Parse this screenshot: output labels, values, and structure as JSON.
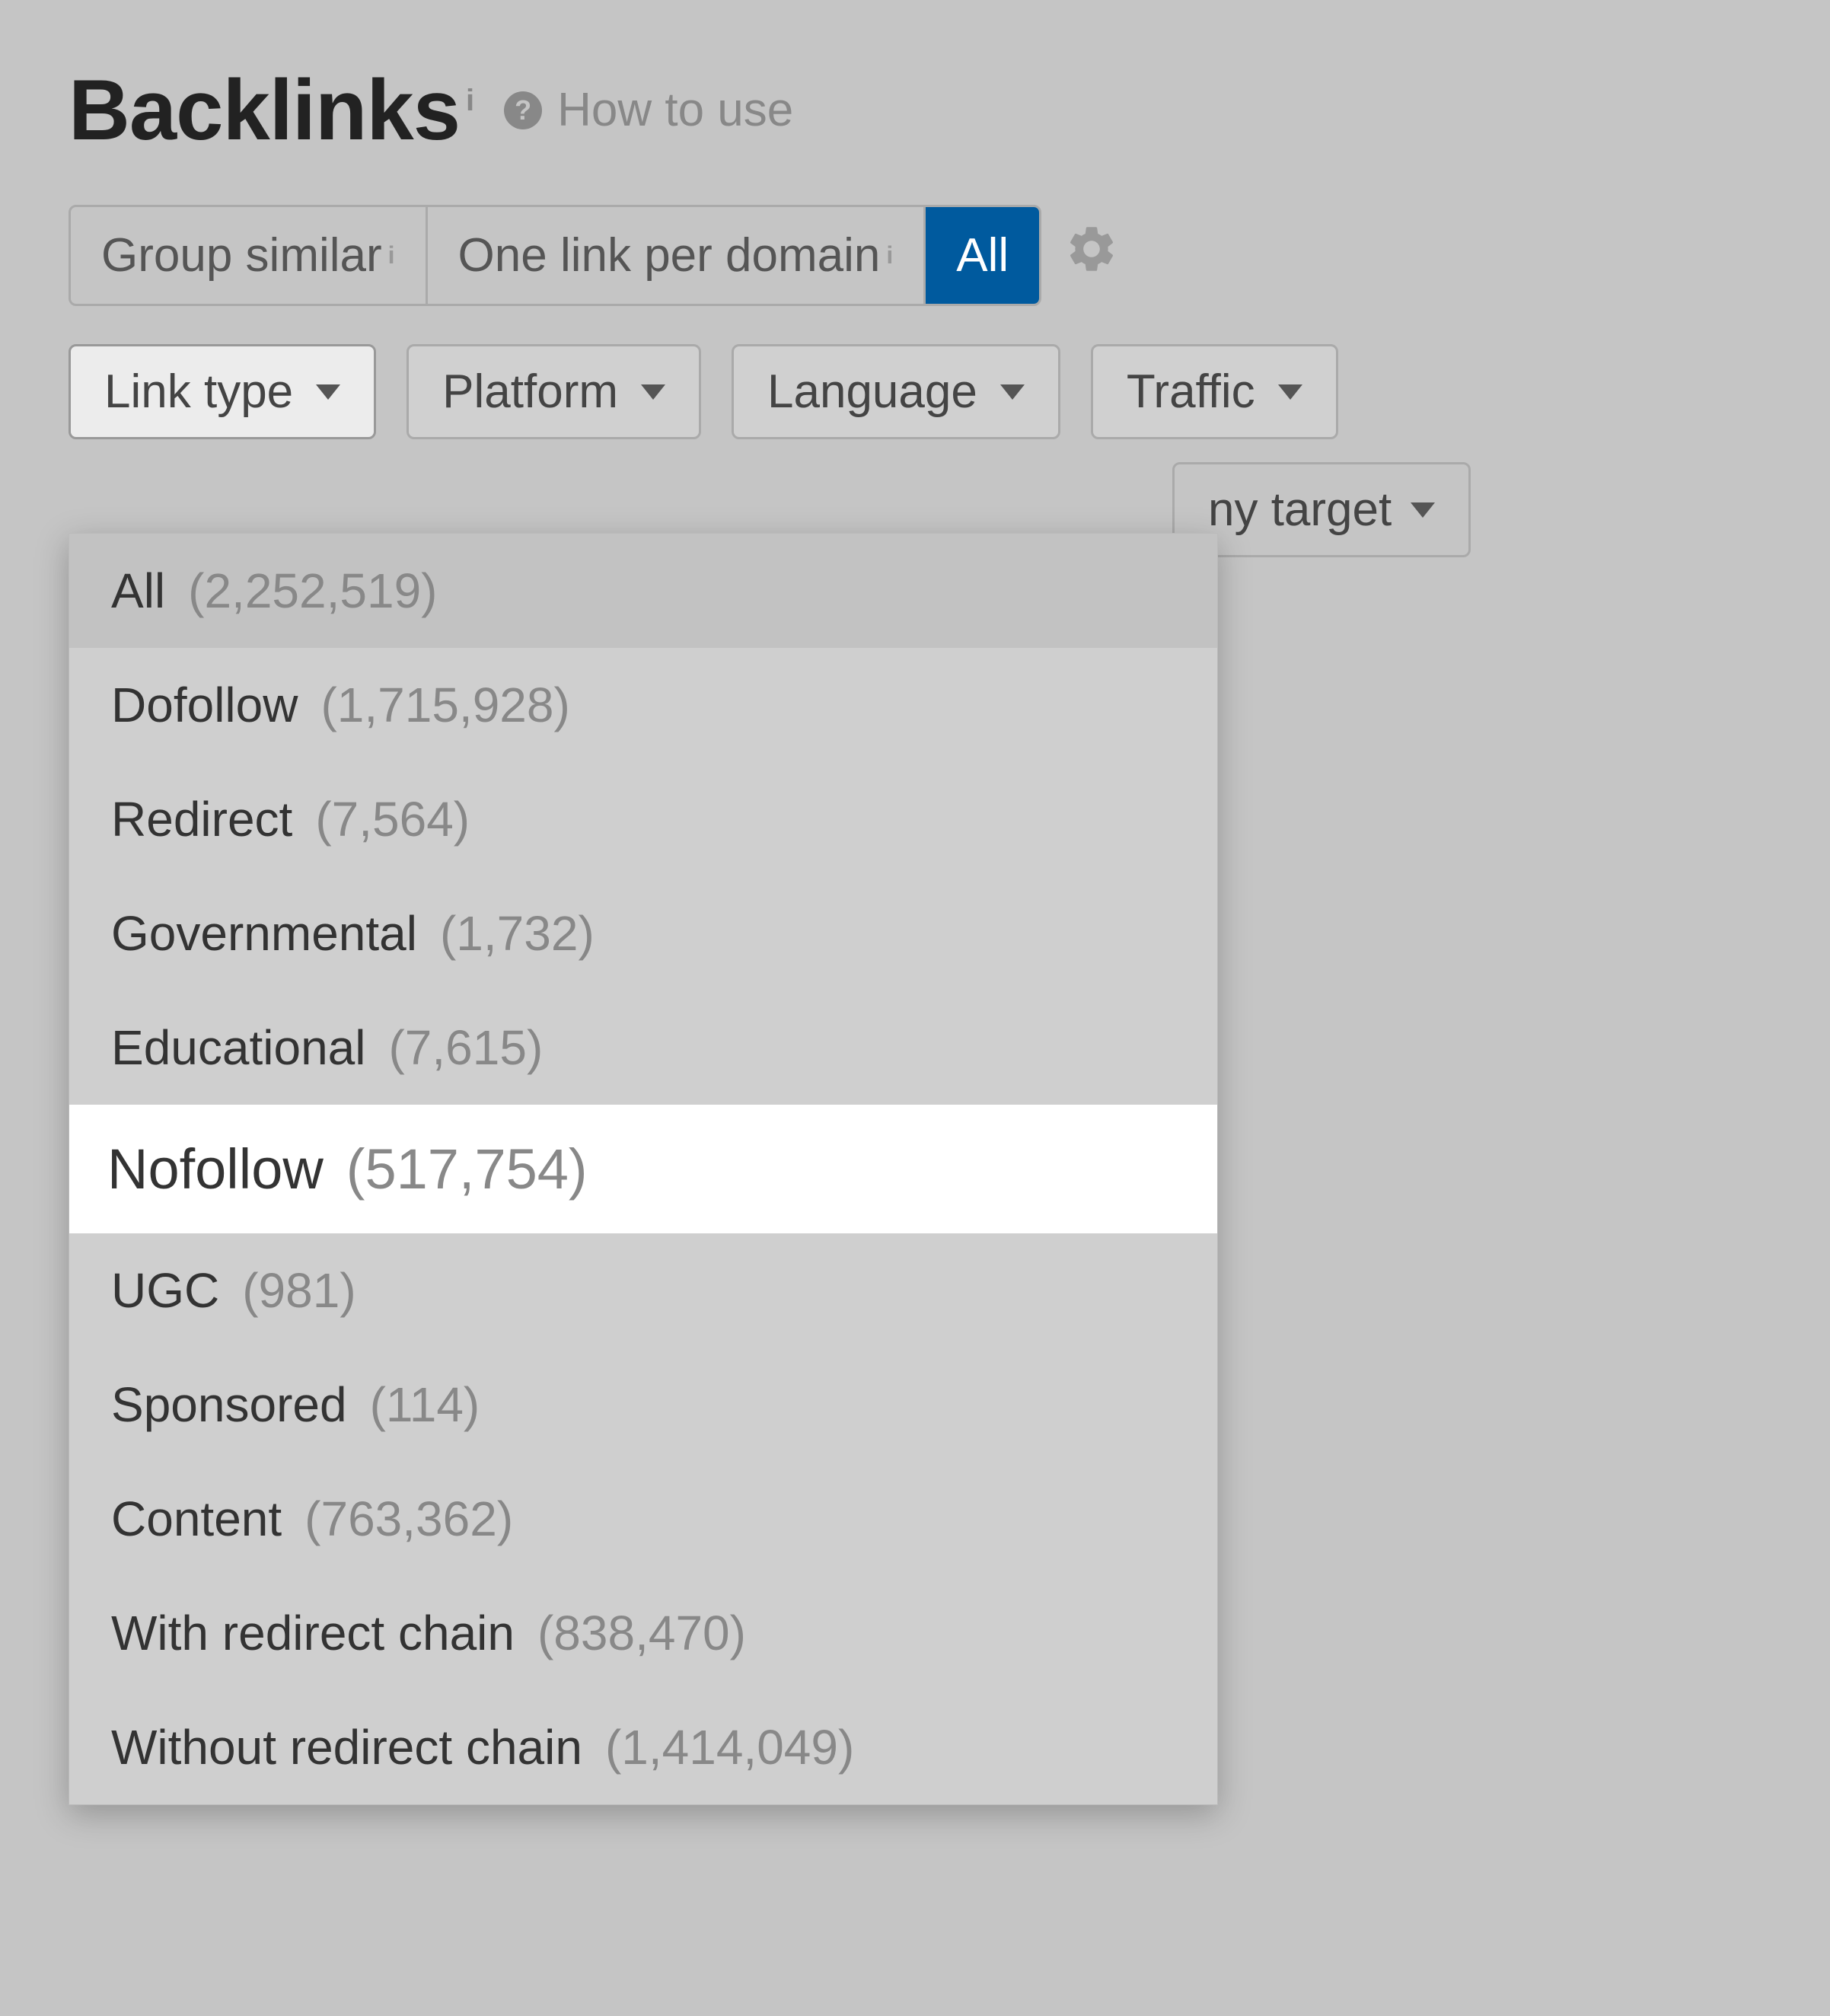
{
  "header": {
    "title": "Backlinks",
    "how_to_use": "How to use"
  },
  "toggles": {
    "group_similar": "Group similar",
    "one_link": "One link per domain",
    "all": "All"
  },
  "filters": {
    "link_type": "Link type",
    "platform": "Platform",
    "language": "Language",
    "traffic": "Traffic"
  },
  "partial_filter": {
    "label": "ny target"
  },
  "link_type_options": [
    {
      "label": "All",
      "count": "(2,252,519)",
      "state": "selected"
    },
    {
      "label": "Dofollow",
      "count": "(1,715,928)",
      "state": ""
    },
    {
      "label": "Redirect",
      "count": "(7,564)",
      "state": ""
    },
    {
      "label": "Governmental",
      "count": "(1,732)",
      "state": ""
    },
    {
      "label": "Educational",
      "count": "(7,615)",
      "state": ""
    },
    {
      "label": "Nofollow",
      "count": "(517,754)",
      "state": "hover"
    },
    {
      "label": "UGC",
      "count": "(981)",
      "state": ""
    },
    {
      "label": "Sponsored",
      "count": "(114)",
      "state": ""
    },
    {
      "label": "Content",
      "count": "(763,362)",
      "state": ""
    },
    {
      "label": "With redirect chain",
      "count": "(838,470)",
      "state": ""
    },
    {
      "label": "Without redirect chain",
      "count": "(1,414,049)",
      "state": ""
    }
  ]
}
